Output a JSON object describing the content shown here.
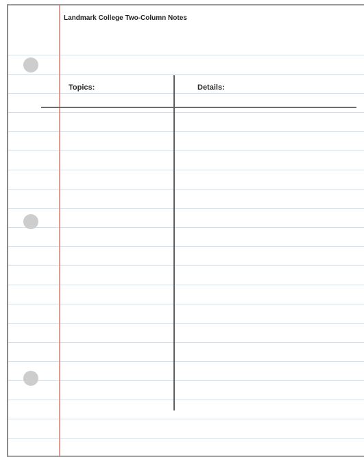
{
  "page": {
    "title": "Landmark College Two-Column Notes"
  },
  "columns": {
    "topics_label": "Topics:",
    "details_label": "Details:"
  },
  "colors": {
    "paper": "#ffffff",
    "ruled_line": "#cfe0f0",
    "margin_line": "#e59a92",
    "divider": "#6d6d6d",
    "punch_hole": "#cdcdcd"
  }
}
